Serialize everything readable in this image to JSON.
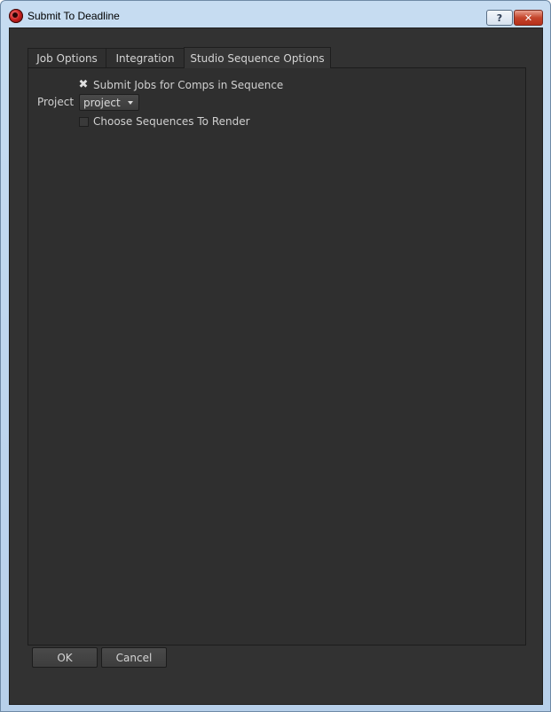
{
  "window": {
    "title": "Submit To Deadline",
    "help_label": "?",
    "close_label": "✕"
  },
  "tabs": [
    {
      "label": "Job Options",
      "active": false
    },
    {
      "label": "Integration",
      "active": false
    },
    {
      "label": "Studio Sequence Options",
      "active": true
    }
  ],
  "panel": {
    "submit_jobs_checkbox": {
      "label": "Submit Jobs for Comps in Sequence",
      "checked": true,
      "mark": "✖"
    },
    "project": {
      "label": "Project",
      "value": "project"
    },
    "choose_sequences_checkbox": {
      "label": "Choose Sequences To Render",
      "checked": false
    }
  },
  "buttons": {
    "ok_label": "OK",
    "cancel_label": "Cancel"
  },
  "colors": {
    "background": "#323232",
    "panel": "#2f2f2f",
    "text": "#d0d0d0",
    "close_button": "#c5452c"
  }
}
